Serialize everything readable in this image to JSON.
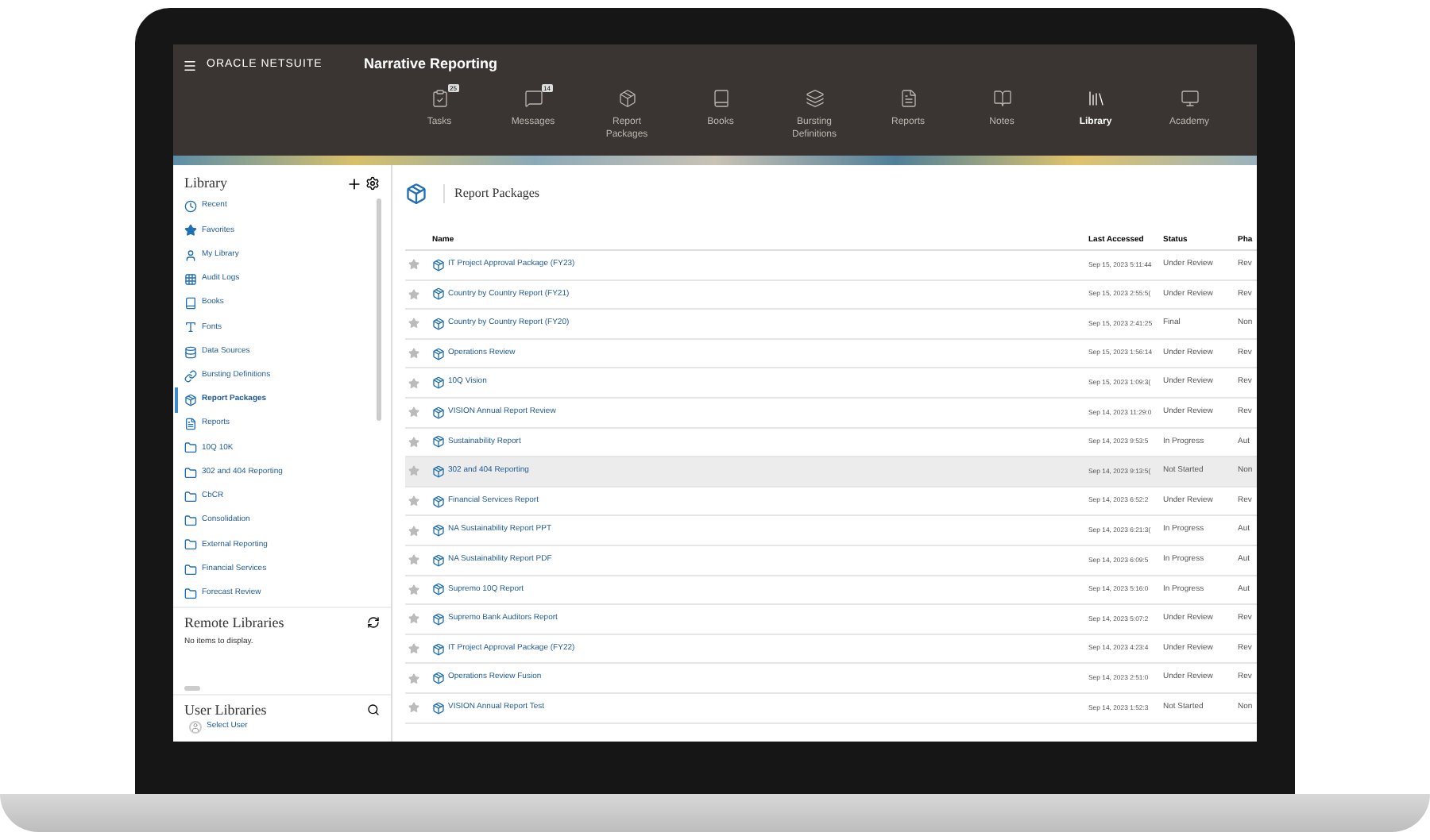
{
  "header": {
    "brand": "ORACLE NETSUITE",
    "title": "Narrative Reporting"
  },
  "nav": [
    {
      "label": "Tasks",
      "kind": "tasks",
      "badge": "25",
      "selected": false
    },
    {
      "label": "Messages",
      "kind": "messages",
      "badge": "14",
      "selected": false
    },
    {
      "label": "Report Packages",
      "kind": "packages",
      "selected": false
    },
    {
      "label": "Books",
      "kind": "books",
      "selected": false
    },
    {
      "label": "Bursting Definitions",
      "kind": "bursting",
      "selected": false
    },
    {
      "label": "Reports",
      "kind": "reports",
      "selected": false
    },
    {
      "label": "Notes",
      "kind": "notes",
      "selected": false
    },
    {
      "label": "Library",
      "kind": "library",
      "selected": true
    },
    {
      "label": "Academy",
      "kind": "academy",
      "selected": false
    }
  ],
  "library": {
    "title": "Library",
    "items": [
      {
        "label": "Recent",
        "kind": "recent",
        "selected": false
      },
      {
        "label": "Favorites",
        "kind": "favorites",
        "selected": false
      },
      {
        "label": "My Library",
        "kind": "user",
        "selected": false
      },
      {
        "label": "Audit Logs",
        "kind": "grid",
        "selected": false
      },
      {
        "label": "Books",
        "kind": "book",
        "selected": false
      },
      {
        "label": "Fonts",
        "kind": "font",
        "selected": false
      },
      {
        "label": "Data Sources",
        "kind": "database",
        "selected": false
      },
      {
        "label": "Bursting Definitions",
        "kind": "link",
        "selected": false
      },
      {
        "label": "Report Packages",
        "kind": "package",
        "selected": true
      },
      {
        "label": "Reports",
        "kind": "report",
        "selected": false
      },
      {
        "label": "10Q 10K",
        "kind": "folder",
        "selected": false
      },
      {
        "label": "302 and 404 Reporting",
        "kind": "folder",
        "selected": false
      },
      {
        "label": "CbCR",
        "kind": "folder",
        "selected": false
      },
      {
        "label": "Consolidation",
        "kind": "folder",
        "selected": false
      },
      {
        "label": "External Reporting",
        "kind": "folder",
        "selected": false
      },
      {
        "label": "Financial Services",
        "kind": "folder",
        "selected": false
      },
      {
        "label": "Forecast Review",
        "kind": "folder",
        "selected": false
      }
    ]
  },
  "remote_libraries": {
    "title": "Remote Libraries",
    "empty_text": "No items to display."
  },
  "user_libraries": {
    "title": "User Libraries",
    "select_user": "Select User"
  },
  "main": {
    "title": "Report Packages",
    "columns": [
      "Name",
      "Last Accessed",
      "Status",
      "Pha"
    ],
    "rows": [
      {
        "name": "IT Project Approval Package (FY23)",
        "last_accessed": "Sep 15, 2023 5:11:44",
        "status": "Under Review",
        "phase": "Rev",
        "selected": false
      },
      {
        "name": "Country by Country Report (FY21)",
        "last_accessed": "Sep 15, 2023 2:55:5(",
        "status": "Under Review",
        "phase": "Rev",
        "selected": false
      },
      {
        "name": "Country by Country Report (FY20)",
        "last_accessed": "Sep 15, 2023 2:41:25",
        "status": "Final",
        "phase": "Non",
        "selected": false
      },
      {
        "name": "Operations Review",
        "last_accessed": "Sep 15, 2023 1:56:14",
        "status": "Under Review",
        "phase": "Rev",
        "selected": false
      },
      {
        "name": "10Q Vision",
        "last_accessed": "Sep 15, 2023 1:09:3(",
        "status": "Under Review",
        "phase": "Rev",
        "selected": false
      },
      {
        "name": "VISION Annual Report Review",
        "last_accessed": "Sep 14, 2023 11:29:0",
        "status": "Under Review",
        "phase": "Rev",
        "selected": false
      },
      {
        "name": "Sustainability Report",
        "last_accessed": "Sep 14, 2023 9:53:5",
        "status": "In Progress",
        "phase": "Aut",
        "selected": false
      },
      {
        "name": "302 and 404 Reporting",
        "last_accessed": "Sep 14, 2023 9:13:5(",
        "status": "Not Started",
        "phase": "Non",
        "selected": true
      },
      {
        "name": "Financial Services Report",
        "last_accessed": "Sep 14, 2023 6:52:2",
        "status": "Under Review",
        "phase": "Rev",
        "selected": false
      },
      {
        "name": "NA Sustainability Report PPT",
        "last_accessed": "Sep 14, 2023 6:21:3(",
        "status": "In Progress",
        "phase": "Aut",
        "selected": false
      },
      {
        "name": "NA Sustainability Report PDF",
        "last_accessed": "Sep 14, 2023 6:09:5",
        "status": "In Progress",
        "phase": "Aut",
        "selected": false
      },
      {
        "name": "Supremo 10Q Report",
        "last_accessed": "Sep 14, 2023 5:16:0",
        "status": "In Progress",
        "phase": "Aut",
        "selected": false
      },
      {
        "name": "Supremo Bank Auditors Report",
        "last_accessed": "Sep 14, 2023 5:07:2",
        "status": "Under Review",
        "phase": "Rev",
        "selected": false
      },
      {
        "name": "IT Project Approval Package (FY22)",
        "last_accessed": "Sep 14, 2023 4:23:4",
        "status": "Under Review",
        "phase": "Rev",
        "selected": false
      },
      {
        "name": "Operations Review Fusion",
        "last_accessed": "Sep 14, 2023 2:51:0",
        "status": "Under Review",
        "phase": "Rev",
        "selected": false
      },
      {
        "name": "VISION Annual Report Test",
        "last_accessed": "Sep 14, 2023 1:52:3",
        "status": "Not Started",
        "phase": "Non",
        "selected": false
      }
    ]
  }
}
